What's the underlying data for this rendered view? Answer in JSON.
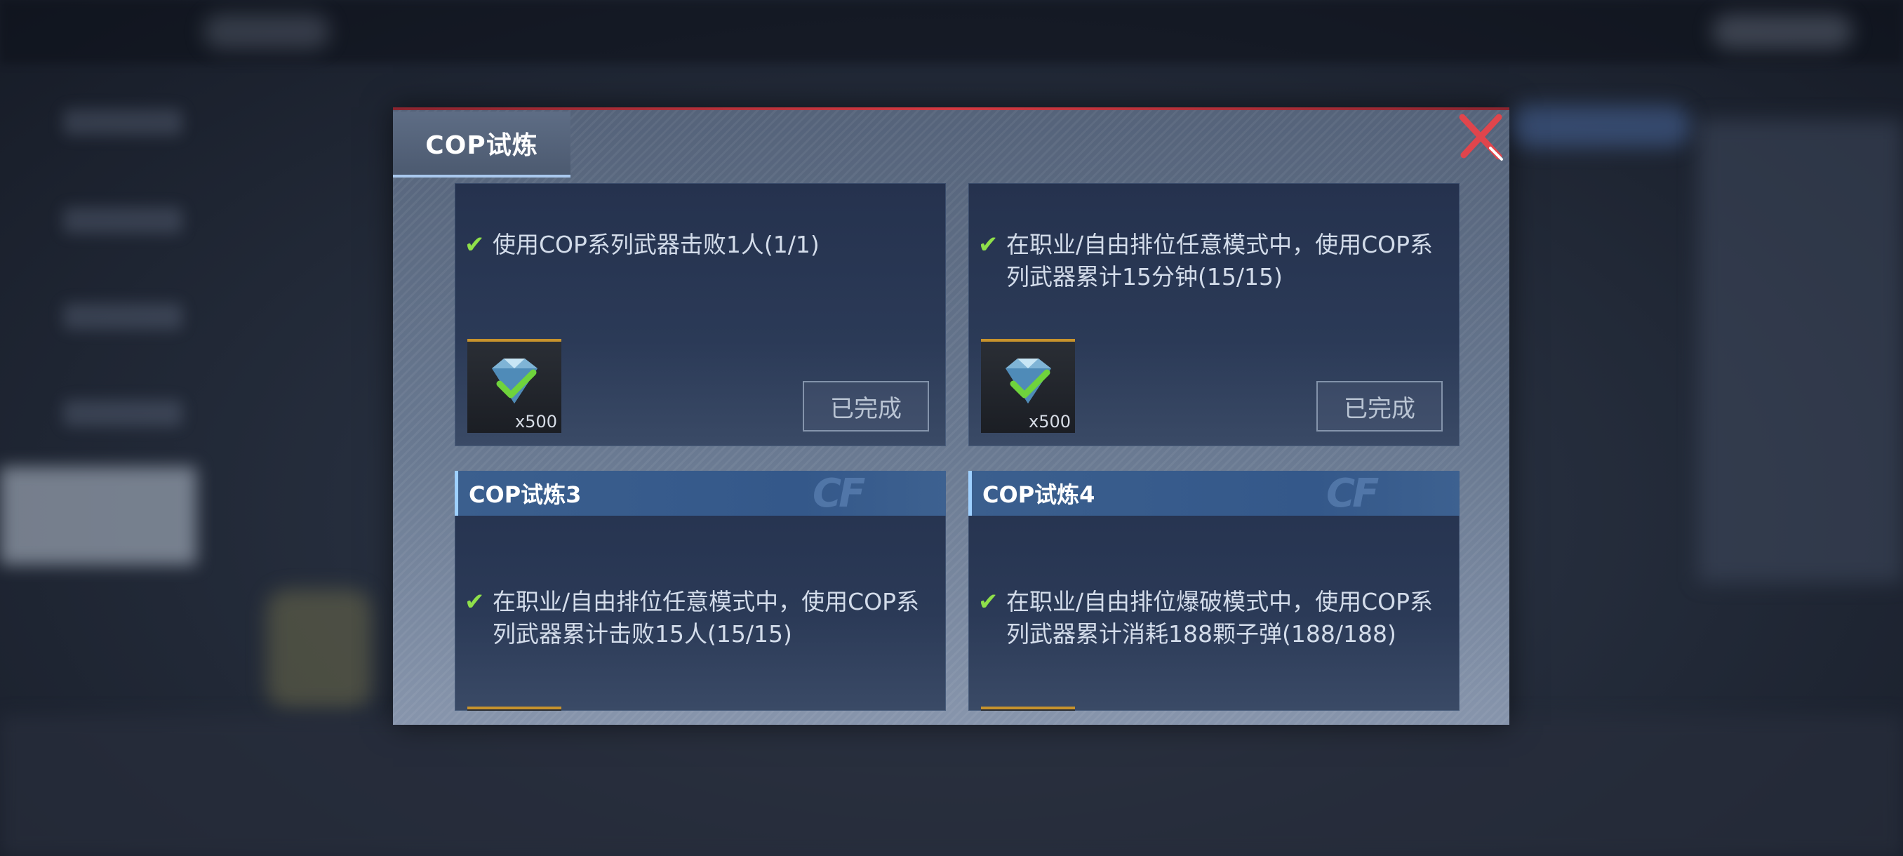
{
  "dialog": {
    "tab_label": "COP试炼",
    "close_icon": "close-x-icon",
    "accent_color": "#d23a42"
  },
  "cards": [
    {
      "title": "",
      "task_lines": [
        "使用COP系列武器击败1人(1/1)"
      ],
      "reward_icon": "diamond-gem-icon",
      "reward_qty": "x500",
      "status_label": "已完成"
    },
    {
      "title": "",
      "task_lines": [
        "在职业/自由排位任意模式中，使用COP系",
        "列武器累计15分钟(15/15)"
      ],
      "reward_icon": "diamond-gem-icon",
      "reward_qty": "x500",
      "status_label": "已完成"
    },
    {
      "title": "COP试炼3",
      "task_lines": [
        "在职业/自由排位任意模式中，使用COP系",
        "列武器累计击败15人(15/15)"
      ]
    },
    {
      "title": "COP试炼4",
      "task_lines": [
        "在职业/自由排位爆破模式中，使用COP系",
        "列武器累计消耗188颗子弹(188/188)"
      ]
    }
  ]
}
